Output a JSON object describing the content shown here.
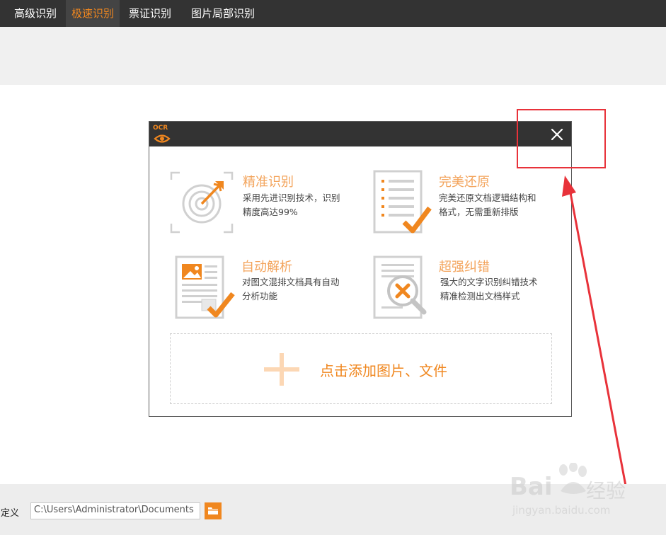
{
  "topbar": {
    "tabs": [
      {
        "label": "高级识别",
        "active": false
      },
      {
        "label": "极速识别",
        "active": true
      },
      {
        "label": "票证识别",
        "active": false
      },
      {
        "label": "图片局部识别",
        "active": false
      }
    ]
  },
  "dialog": {
    "logo_text": "OCR",
    "features": [
      {
        "title": "精准识别",
        "desc_line1": "采用先进识别技术，识别",
        "desc_line2": "精度高达99%",
        "icon": "target-icon"
      },
      {
        "title": "完美还原",
        "desc_line1": "完美还原文档逻辑结构和",
        "desc_line2": "格式，无需重新排版",
        "icon": "document-check-icon"
      },
      {
        "title": "自动解析",
        "desc_line1": "对图文混排文档具有自动",
        "desc_line2": "分析功能",
        "icon": "image-document-icon"
      },
      {
        "title": "超强纠错",
        "desc_line1": "强大的文字识别纠错技术",
        "desc_line2": "精准检测出文档样式",
        "icon": "magnifier-error-icon"
      }
    ],
    "add_label": "点击添加图片、文件"
  },
  "bottom": {
    "path_label": "自定义",
    "path_value": "C:\\Users\\Administrator\\Documents"
  },
  "watermark": {
    "brand": "Bai",
    "brand2": "经验",
    "url": "jingyan.baidu.com"
  },
  "colors": {
    "accent": "#f0871f",
    "light_accent": "#f3a45c",
    "dark": "#333333",
    "annotation": "#e8323a"
  }
}
